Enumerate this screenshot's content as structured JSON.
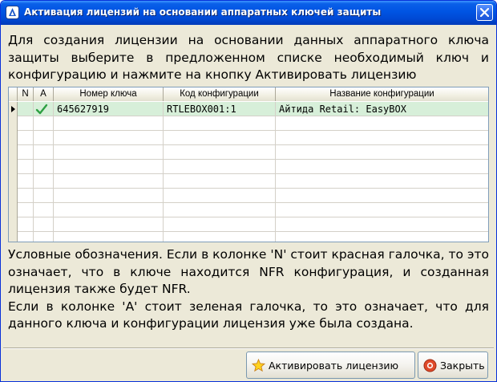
{
  "window": {
    "title": "Активация лицензий на основании аппаратных ключей защиты"
  },
  "intro_text": "Для создания лицензии на основании данных аппаратного ключа защиты выберите в предложенном списке необходимый ключ и конфигурацию и нажмите на кнопку Активировать лицензию",
  "grid": {
    "columns": {
      "n": "N",
      "a": "A",
      "key_number": "Номер ключа",
      "config_code": "Код конфигурации",
      "config_name": "Название конфигурации"
    },
    "rows": [
      {
        "key_number": "645627919",
        "config_code": "RTLEBOX001:1",
        "config_name": "Айтида Retail: EasyBOX",
        "a_checked": true,
        "selected": true
      }
    ]
  },
  "legend": {
    "line1": "Условные обозначения. Если в колонке 'N' стоит красная галочка, то это означает, что в ключе находится NFR конфигурация, и созданная лицензия также будет NFR.",
    "line2": "Если в колонке 'A' стоит зеленая галочка, то это означает, что для данного ключа и конфигурации лицензия уже была создана."
  },
  "buttons": {
    "activate": "Активировать лицензию",
    "close": "Закрыть"
  },
  "colors": {
    "selected_row": "#d7efd9",
    "check_green": "#2ea043",
    "title_bar": "#0054e3"
  },
  "icons": {
    "app": "app-icon",
    "star": "star-icon",
    "close": "close-icon"
  }
}
